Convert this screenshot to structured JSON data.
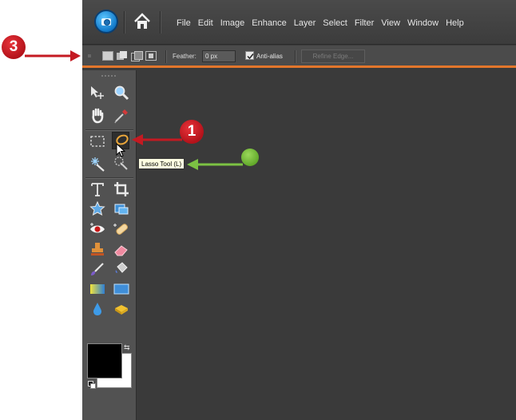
{
  "menu": {
    "items": [
      "File",
      "Edit",
      "Image",
      "Enhance",
      "Layer",
      "Select",
      "Filter",
      "View",
      "Window",
      "Help"
    ]
  },
  "options": {
    "feather_label": "Feather:",
    "feather_value": "0 px",
    "anti_alias_label": "Anti-alias",
    "anti_alias_checked": true,
    "refine_edge_label": "Refine Edge..."
  },
  "tools": {
    "tooltip": "Lasso Tool (L)",
    "selected": "lasso-tool"
  },
  "callouts": {
    "step_3": "3",
    "step_1": "1"
  },
  "colors": {
    "accent_orange": "#e3762b",
    "callout_red": "#c41a22",
    "callout_green": "#7cc243",
    "foreground": "#000000",
    "background": "#ffffff"
  }
}
